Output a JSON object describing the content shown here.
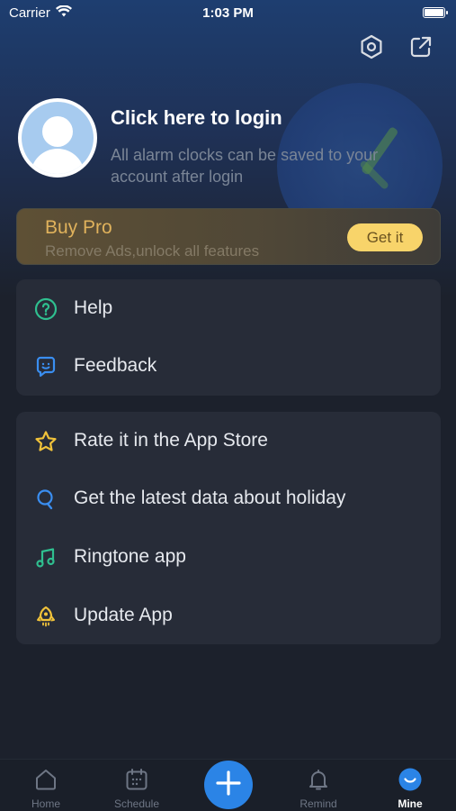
{
  "status_bar": {
    "carrier": "Carrier",
    "time": "1:03 PM"
  },
  "header": {
    "settings_icon": "hexagon-gear-icon",
    "share_icon": "share-external-icon"
  },
  "profile": {
    "login_title": "Click here to login",
    "login_subtitle": "All alarm clocks can be saved to your account after login"
  },
  "buy_pro": {
    "title": "Buy Pro",
    "subtitle": "Remove Ads,unlock all features",
    "button_label": "Get it"
  },
  "menu_group_1": [
    {
      "label": "Help",
      "icon": "help-circle-icon"
    },
    {
      "label": "Feedback",
      "icon": "feedback-icon"
    }
  ],
  "menu_group_2": [
    {
      "label": "Rate it in the App Store",
      "icon": "star-icon"
    },
    {
      "label": "Get the latest data about holiday",
      "icon": "search-icon"
    },
    {
      "label": "Ringtone app",
      "icon": "music-note-icon"
    },
    {
      "label": "Update App",
      "icon": "rocket-icon"
    }
  ],
  "tab_bar": {
    "tabs": [
      {
        "label": "Home",
        "icon": "home-icon"
      },
      {
        "label": "Schedule",
        "icon": "calendar-icon"
      },
      {
        "label": "Remind",
        "icon": "bell-icon"
      },
      {
        "label": "Mine",
        "icon": "smile-face-icon"
      }
    ],
    "active": "Mine"
  },
  "colors": {
    "accent": "#2b84e6",
    "gold": "#e0b25c",
    "help_icon": "#2fbf8f",
    "feedback_icon": "#3a8ef0",
    "star_icon": "#f0c23a",
    "holiday_icon": "#3a8ef0",
    "ringtone_icon": "#2fbf8f",
    "update_icon": "#f0c23a"
  }
}
